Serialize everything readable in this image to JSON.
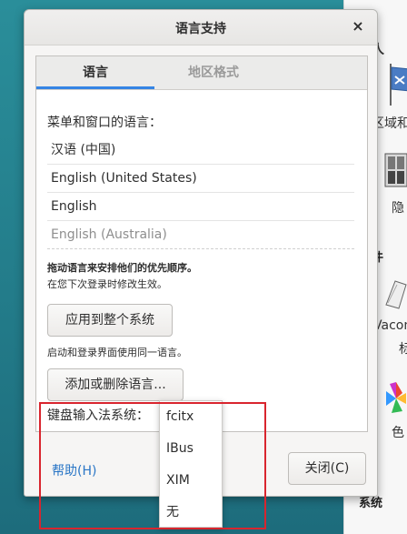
{
  "background_window": {
    "labels": [
      "人",
      "区域和",
      "隐",
      "件",
      "Vacon",
      "标",
      "色",
      "系统"
    ]
  },
  "dialog": {
    "title": "语言支持",
    "close_glyph": "×",
    "tabs": [
      {
        "label": "语言",
        "active": true
      },
      {
        "label": "地区格式",
        "active": false
      }
    ],
    "menu_language_label": "菜单和窗口的语言：",
    "languages": [
      "汉语 (中国)",
      "English (United States)",
      "English",
      "English (Australia)"
    ],
    "drag_hint": "拖动语言来安排他们的优先顺序。",
    "effect_hint": "在您下次登录时修改生效。",
    "apply_system_button": "应用到整个系统",
    "login_hint": "启动和登录界面使用同一语言。",
    "add_remove_button": "添加或删除语言...",
    "keyboard_input_label": "键盘输入法系统：",
    "help_link": "帮助(H)",
    "close_button": "关闭(C)"
  },
  "input_method_dropdown": {
    "options": [
      "fcitx",
      "IBus",
      "XIM",
      "无"
    ]
  },
  "colors": {
    "accent": "#3584e4",
    "link": "#2a76c6",
    "highlight_border": "#d9252e"
  }
}
